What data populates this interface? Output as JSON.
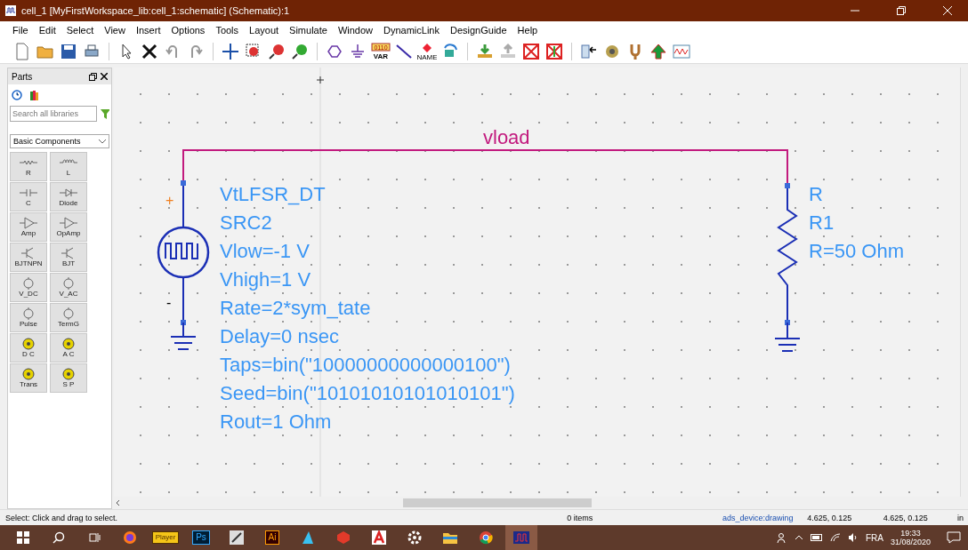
{
  "window": {
    "title": "cell_1 [MyFirstWorkspace_lib:cell_1:schematic] (Schematic):1"
  },
  "menu": [
    "File",
    "Edit",
    "Select",
    "View",
    "Insert",
    "Options",
    "Tools",
    "Layout",
    "Simulate",
    "Window",
    "DynamicLink",
    "DesignGuide",
    "Help"
  ],
  "toolbar": {
    "var_bits": "0110",
    "var_text": "VAR",
    "name_text": "NAME"
  },
  "parts_panel": {
    "title": "Parts",
    "search": {
      "placeholder": "Search all libraries"
    },
    "library": "Basic Components",
    "parts": [
      {
        "label": "R",
        "kind": "resistor"
      },
      {
        "label": "L",
        "kind": "inductor"
      },
      {
        "label": "C",
        "kind": "capacitor"
      },
      {
        "label": "Diode",
        "kind": "diode"
      },
      {
        "label": "Amp",
        "kind": "amp"
      },
      {
        "label": "OpAmp",
        "kind": "amp"
      },
      {
        "label": "BJTNPN",
        "kind": "transistor"
      },
      {
        "label": "BJT",
        "kind": "transistor"
      },
      {
        "label": "V_DC",
        "kind": "source"
      },
      {
        "label": "V_AC",
        "kind": "source"
      },
      {
        "label": "Pulse",
        "kind": "source"
      },
      {
        "label": "TermG",
        "kind": "source"
      },
      {
        "label": "D C",
        "kind": "controller"
      },
      {
        "label": "A C",
        "kind": "controller"
      },
      {
        "label": "Trans",
        "kind": "controller"
      },
      {
        "label": "S P",
        "kind": "controller"
      }
    ]
  },
  "schematic": {
    "net_label": "vload",
    "source": {
      "plus": "+",
      "minus": "-",
      "labels": [
        "VtLFSR_DT",
        "SRC2",
        "Vlow=-1 V",
        "Vhigh=1 V",
        "Rate=2*sym_tate",
        "Delay=0 nsec",
        "Taps=bin(\"10000000000000100\")",
        "Seed=bin(\"10101010101010101\")",
        "Rout=1 Ohm"
      ]
    },
    "resistor": {
      "labels": [
        "R",
        "R1",
        "R=50 Ohm"
      ]
    }
  },
  "status_bar": {
    "hint": "Select: Click and drag to select.",
    "items": "0 items",
    "layer": "ads_device:drawing",
    "coords_1": "4.625, 0.125",
    "coords_2": "4.625, 0.125",
    "units": "in"
  },
  "taskbar": {
    "player_label": "Player",
    "ps_label": "Ps",
    "ai_label": "Ai",
    "language": "FRA",
    "time": "19:33",
    "date": "31/08/2020"
  }
}
